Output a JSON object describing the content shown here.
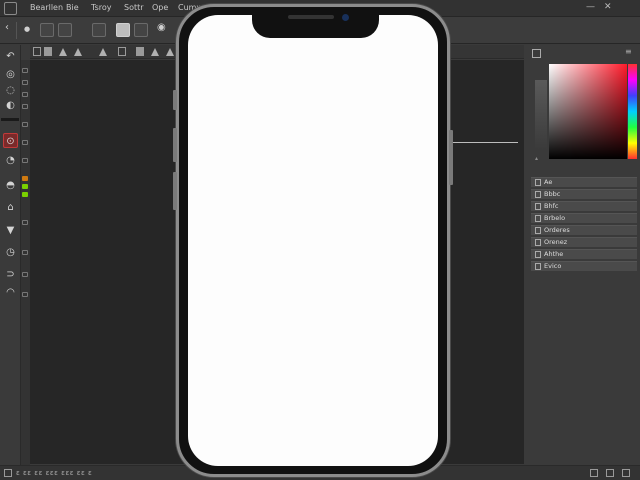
{
  "menu": {
    "items": [
      "Bearllen",
      "Bie",
      "Tsroy",
      "Sottr",
      "Ope",
      "Cumwsi"
    ]
  },
  "window_controls": {
    "minimize": "—",
    "close": "✕"
  },
  "options": {
    "tool_icons": [
      "back-chevron-icon",
      "dot-icon",
      "ellipse-icon",
      "layout-icon",
      "grid-icon",
      "record-icon",
      "square-icon"
    ]
  },
  "tabs": {
    "icons": [
      "square",
      "square",
      "triangle",
      "triangle",
      "triangle",
      "square",
      "square",
      "triangle",
      "triangle"
    ]
  },
  "tools": [
    "↶",
    "◎",
    "◌",
    "◐",
    "⊙",
    "◔",
    "◓",
    "⌂",
    "▼",
    "◷",
    "⊃",
    "◠"
  ],
  "color_panel": {
    "tab_label": "",
    "marker": "▴"
  },
  "layers": [
    {
      "label": "Ae"
    },
    {
      "label": "Bbbc"
    },
    {
      "label": "Bhfc"
    },
    {
      "label": "Brbelo"
    },
    {
      "label": "Orderes"
    },
    {
      "label": "Orenez"
    },
    {
      "label": "Ahthe"
    },
    {
      "label": "Evico"
    }
  ],
  "status": {
    "text": "ɛ ɛɛ ɛɛ ɛɛɛ ɛɛɛ ɛɛ ɛ"
  },
  "colors": {
    "accent": "#c23a3a",
    "orange": "#d07a10",
    "green": "#7ad000"
  }
}
